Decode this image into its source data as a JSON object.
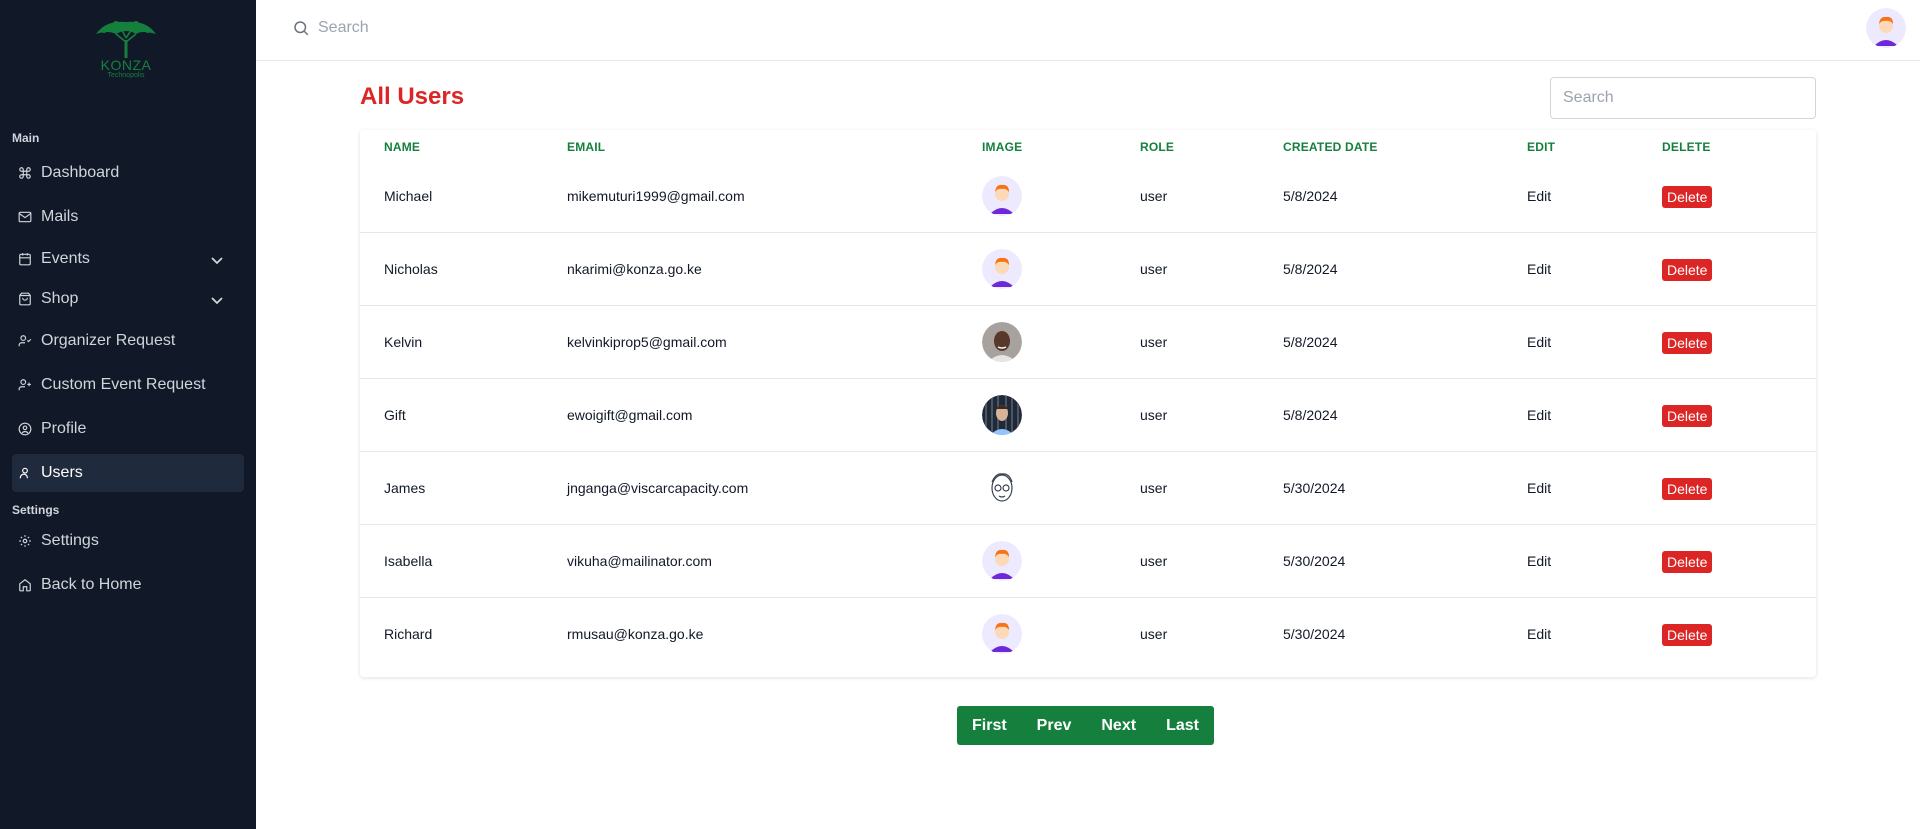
{
  "brand": {
    "name": "KONZA",
    "subtitle": "Technopolis",
    "color": "#15803d"
  },
  "sidebar": {
    "sections": {
      "main": "Main",
      "settings": "Settings"
    },
    "items": [
      {
        "label": "Dashboard",
        "icon": "command-icon"
      },
      {
        "label": "Mails",
        "icon": "mail-icon"
      },
      {
        "label": "Events",
        "icon": "calendar-icon",
        "expandable": true
      },
      {
        "label": "Shop",
        "icon": "bag-icon",
        "expandable": true
      },
      {
        "label": "Organizer Request",
        "icon": "user-check-icon"
      },
      {
        "label": "Custom Event Request",
        "icon": "user-plus-icon"
      },
      {
        "label": "Profile",
        "icon": "user-circle-icon"
      },
      {
        "label": "Users",
        "icon": "user-icon",
        "active": true
      },
      {
        "label": "Settings",
        "icon": "gear-icon"
      },
      {
        "label": "Back to Home",
        "icon": "home-icon"
      }
    ]
  },
  "topbar": {
    "search_placeholder": "Search"
  },
  "main": {
    "title": "All Users",
    "search_placeholder": "Search",
    "columns": [
      "Name",
      "Email",
      "Image",
      "Role",
      "Created Date",
      "Edit",
      "Delete"
    ],
    "rows": [
      {
        "name": "Michael",
        "email": "mikemuturi1999@gmail.com",
        "avatar": "cartoon-avatar",
        "role": "user",
        "created": "5/8/2024",
        "edit": "Edit",
        "delete": "Delete"
      },
      {
        "name": "Nicholas",
        "email": "nkarimi@konza.go.ke",
        "avatar": "cartoon-avatar",
        "role": "user",
        "created": "5/8/2024",
        "edit": "Edit",
        "delete": "Delete"
      },
      {
        "name": "Kelvin",
        "email": "kelvinkiprop5@gmail.com",
        "avatar": "photo-avatar",
        "role": "user",
        "created": "5/8/2024",
        "edit": "Edit",
        "delete": "Delete"
      },
      {
        "name": "Gift",
        "email": "ewoigift@gmail.com",
        "avatar": "photo-avatar-dark",
        "role": "user",
        "created": "5/8/2024",
        "edit": "Edit",
        "delete": "Delete"
      },
      {
        "name": "James",
        "email": "jnganga@viscarcapacity.com",
        "avatar": "sketch-avatar",
        "role": "user",
        "created": "5/30/2024",
        "edit": "Edit",
        "delete": "Delete"
      },
      {
        "name": "Isabella",
        "email": "vikuha@mailinator.com",
        "avatar": "cartoon-avatar",
        "role": "user",
        "created": "5/30/2024",
        "edit": "Edit",
        "delete": "Delete"
      },
      {
        "name": "Richard",
        "email": "rmusau@konza.go.ke",
        "avatar": "cartoon-avatar",
        "role": "user",
        "created": "5/30/2024",
        "edit": "Edit",
        "delete": "Delete"
      }
    ],
    "pagination": [
      "First",
      "Prev",
      "Next",
      "Last"
    ]
  },
  "colors": {
    "accent_red": "#dc2626",
    "accent_green": "#15803d",
    "sidebar_bg": "#111827"
  }
}
